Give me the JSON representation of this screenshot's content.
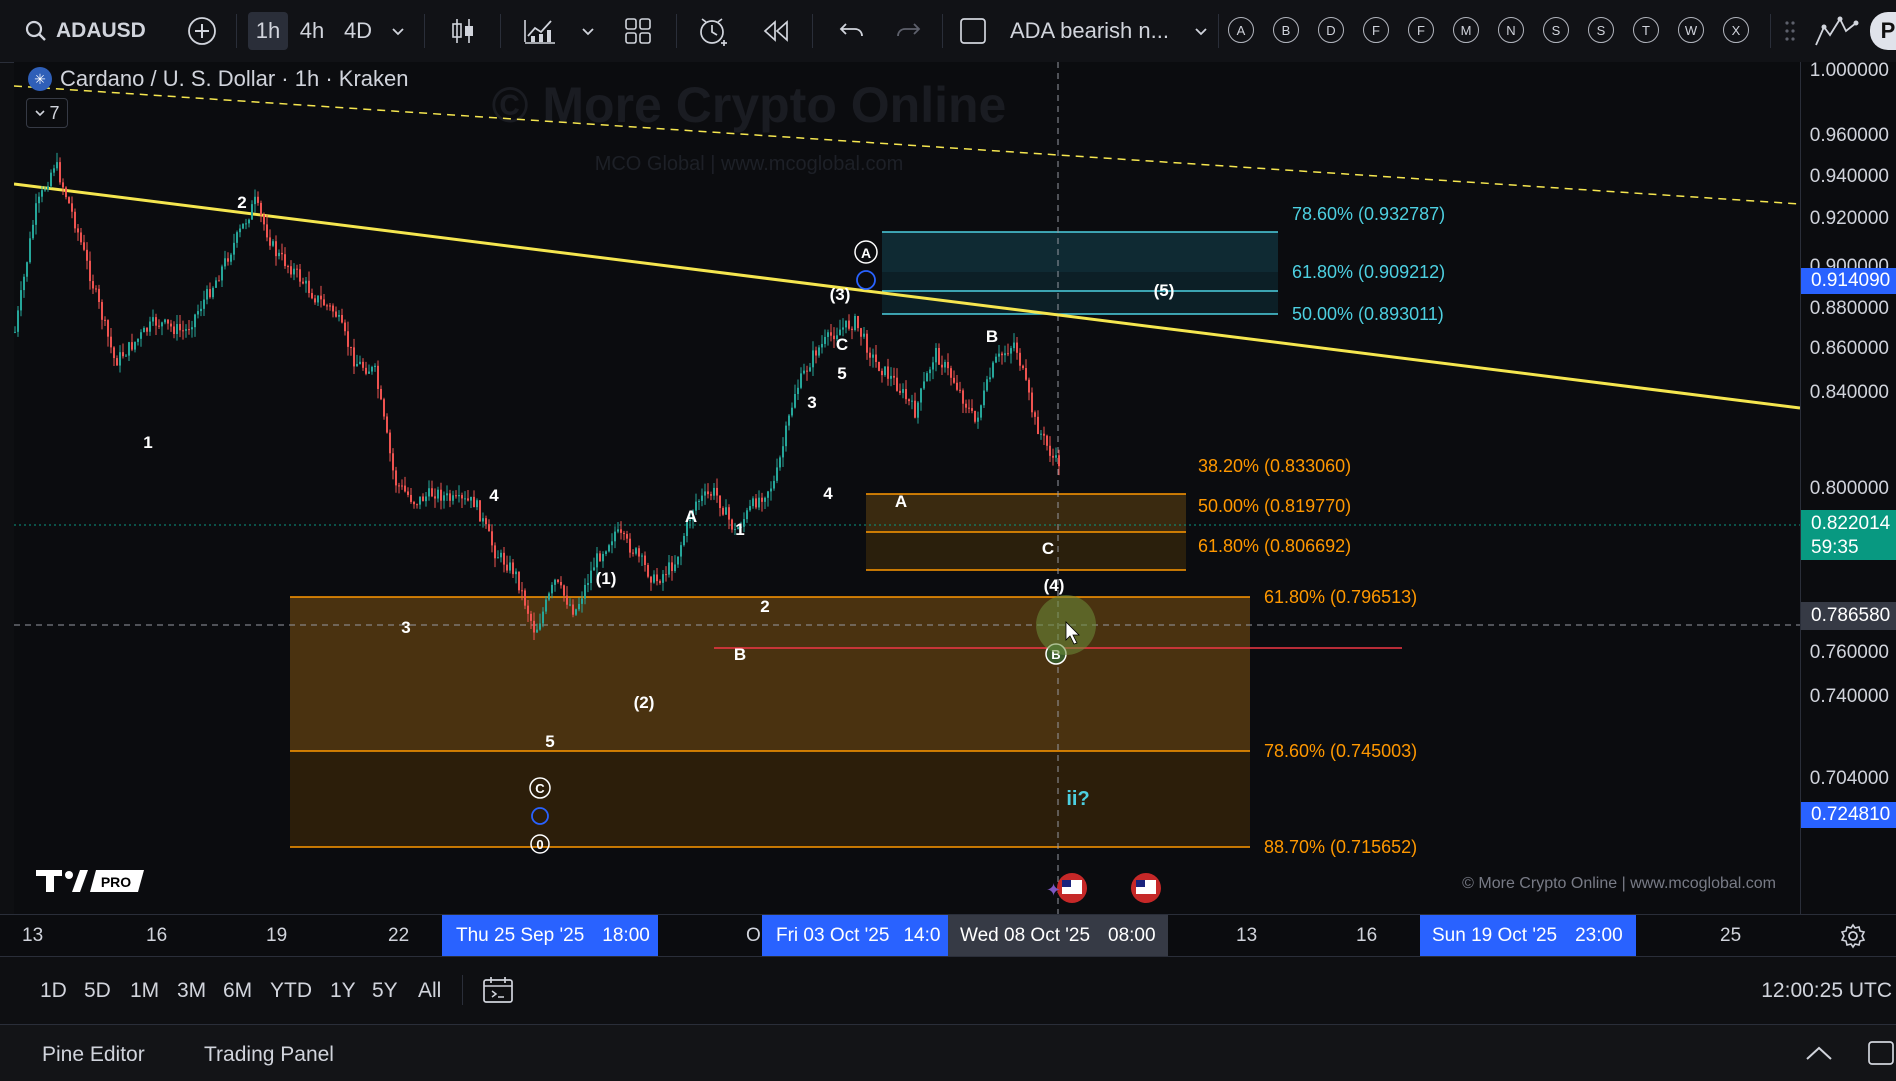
{
  "toolbar": {
    "symbol": "ADAUSD",
    "timeframes": [
      "1h",
      "4h",
      "4D"
    ],
    "layout_name": "ADA bearish n...",
    "letters": [
      "A",
      "B",
      "D",
      "F",
      "F",
      "M",
      "N",
      "S",
      "S",
      "T",
      "W",
      "X"
    ],
    "avatar": "P"
  },
  "legend": {
    "title": "Cardano / U. S. Dollar · 1h · Kraken",
    "collapse_count": "7"
  },
  "watermark": {
    "main": "© More Crypto Online",
    "sub": "MCO Global  |  www.mcoglobal.com",
    "footer": "© More Crypto Online  |  www.mcoglobal.com",
    "logo": "PRO"
  },
  "price_axis": {
    "labels": [
      "1.000000",
      "0.960000",
      "0.940000",
      "0.920000",
      "0.900000",
      "0.880000",
      "0.860000",
      "0.840000",
      "0.800000",
      "0.780000",
      "0.760000",
      "0.740000",
      "0.720000",
      "0.704000"
    ],
    "badges": {
      "level_high": "0.914090",
      "current": "0.822014",
      "countdown": "59:35",
      "crosshair": "0.786580",
      "level_low": "0.724810"
    },
    "colors": {
      "blue": "#2962ff",
      "green": "#089981",
      "gray": "#363a45"
    }
  },
  "fib": {
    "upper": [
      {
        "label": "78.60% (0.932787)"
      },
      {
        "label": "61.80% (0.909212)"
      },
      {
        "label": "50.00% (0.893011)"
      }
    ],
    "middle": [
      {
        "label": "38.20% (0.833060)"
      },
      {
        "label": "50.00% (0.819770)"
      },
      {
        "label": "61.80% (0.806692)"
      }
    ],
    "lower": [
      {
        "label": "61.80% (0.796513)"
      },
      {
        "label": "78.60% (0.745003)"
      },
      {
        "label": "88.70% (0.715652)"
      }
    ],
    "colors": {
      "cyan": "#4dd0e1",
      "orange": "#ff9800",
      "trend": "#f5e64f"
    }
  },
  "wave_labels": [
    "2",
    "1",
    "3",
    "4",
    "5",
    "A",
    "1",
    "2",
    "B",
    "3",
    "4",
    "5",
    "C",
    "A",
    "B",
    "C",
    "(1)",
    "(2)",
    "(3)",
    "(4)",
    "(5)",
    "A",
    "B",
    "C",
    "0",
    "ii?"
  ],
  "time_axis": {
    "ticks": [
      "13",
      "16",
      "19",
      "22",
      "O",
      "13",
      "16",
      "25"
    ],
    "selected": [
      {
        "date": "Thu 25 Sep '25",
        "time": "18:00"
      },
      {
        "date": "Fri 03 Oct '25",
        "time": "14:0"
      },
      {
        "date": "Wed 08 Oct '25",
        "time": "08:00"
      },
      {
        "date": "Sun 19 Oct '25",
        "time": "23:00"
      }
    ]
  },
  "range_bar": {
    "ranges": [
      "1D",
      "5D",
      "1M",
      "3M",
      "6M",
      "YTD",
      "1Y",
      "5Y",
      "All"
    ],
    "clock": "12:00:25 UTC"
  },
  "bottom_bar": {
    "tabs": [
      "Pine Editor",
      "Trading Panel"
    ]
  }
}
